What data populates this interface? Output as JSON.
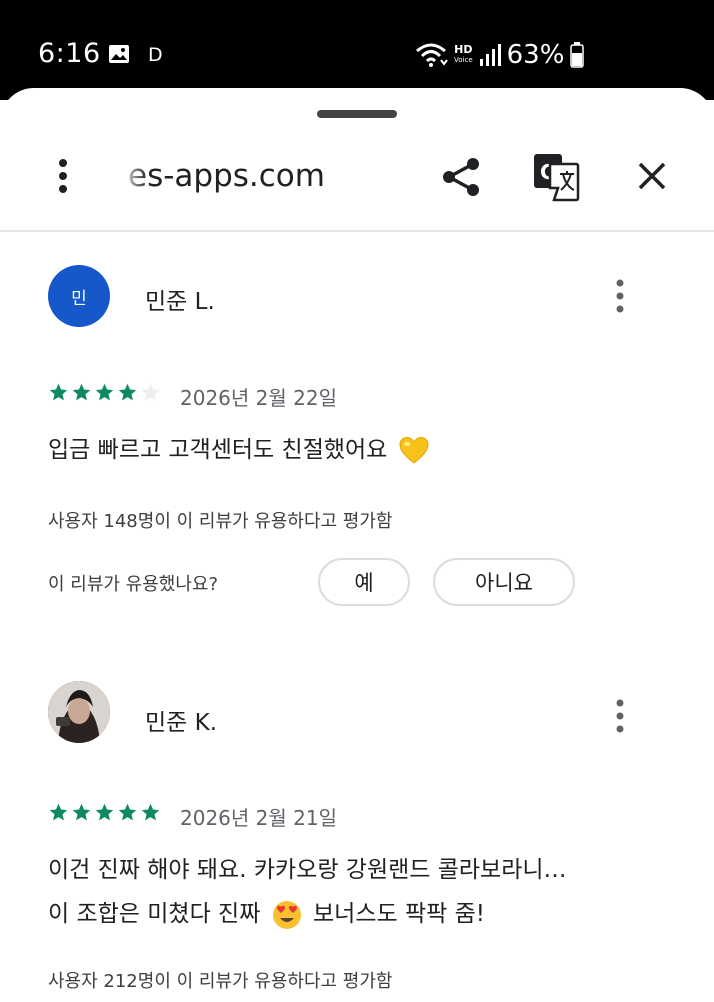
{
  "status_bar": {
    "time": "6:16",
    "indicator": "D",
    "hd_label": "HD",
    "hd_sub": "Voice",
    "battery": "63%"
  },
  "toolbar": {
    "url": "es-apps.com",
    "icons": [
      "more-vert-icon",
      "share-icon",
      "translate-icon",
      "close-icon"
    ]
  },
  "reviews": [
    {
      "avatar_letter": "민",
      "avatar_color": "#1657c9",
      "name": "민준 L.",
      "rating": 4,
      "date": "2026년 2월 22일",
      "text": "입금 빠르고 고객센터도 친절했어요",
      "emoji": "yellow-heart",
      "helpful": "사용자 148명이 이 리뷰가 유용하다고 평가함",
      "question": "이 리뷰가 유용했나요?",
      "yes": "예",
      "no": "아니요"
    },
    {
      "name": "민준 K.",
      "rating": 5,
      "date": "2026년 2월 21일",
      "text_line1": "이건 진짜 해야 돼요. 카카오랑 강원랜드 콜라보라니…",
      "text_line2a": "이 조합은 미쳤다 진짜",
      "text_line2b": "보너스도 팍팍 줌!",
      "emoji": "heart-eyes",
      "helpful": "사용자 212명이 이 리뷰가 유용하다고 평가함"
    }
  ],
  "colors": {
    "star": "#0f8a5f",
    "star_empty": "#e0e0e0",
    "avatar_blue": "#1657c9"
  }
}
